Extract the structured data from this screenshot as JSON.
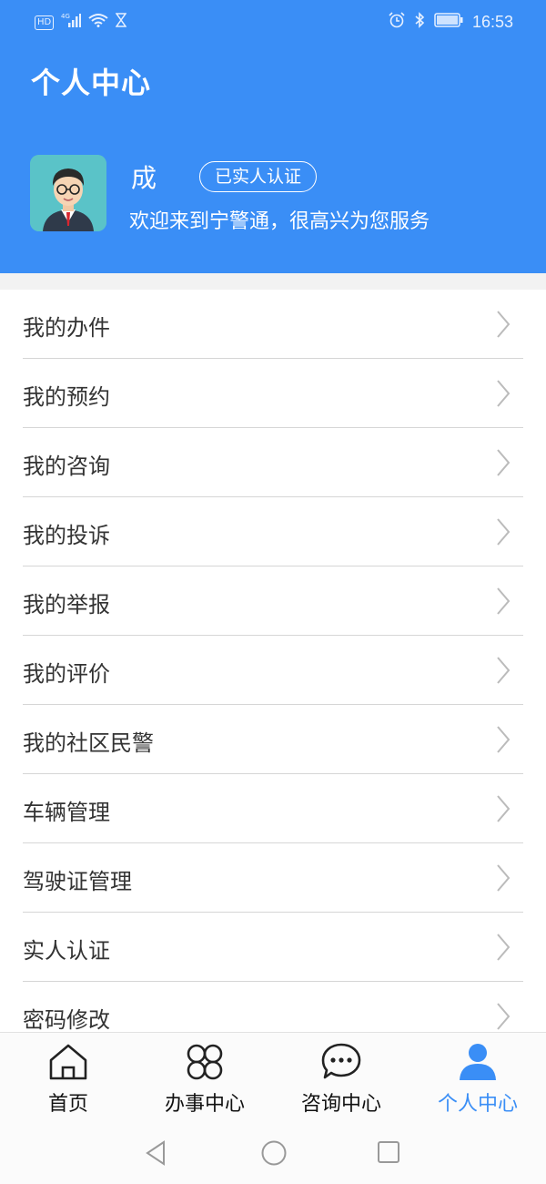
{
  "status_bar": {
    "network_badge": "HD",
    "signal": "4G",
    "time": "16:53",
    "icons": [
      "hd-icon",
      "signal-icon",
      "wifi-icon",
      "hourglass-icon",
      "alarm-icon",
      "bluetooth-icon",
      "battery-icon"
    ]
  },
  "header": {
    "title": "个人中心",
    "user_name": "成",
    "badge": "已实人认证",
    "welcome": "欢迎来到宁警通，很高兴为您服务",
    "accent_color": "#3a8ef6"
  },
  "menu": {
    "items": [
      {
        "label": "我的办件"
      },
      {
        "label": "我的预约"
      },
      {
        "label": "我的咨询"
      },
      {
        "label": "我的投诉"
      },
      {
        "label": "我的举报"
      },
      {
        "label": "我的评价"
      },
      {
        "label": "我的社区民警"
      },
      {
        "label": "车辆管理"
      },
      {
        "label": "驾驶证管理"
      },
      {
        "label": "实人认证"
      },
      {
        "label": "密码修改"
      }
    ]
  },
  "tabbar": {
    "tabs": [
      {
        "label": "首页",
        "icon": "home-icon"
      },
      {
        "label": "办事中心",
        "icon": "clover-icon"
      },
      {
        "label": "咨询中心",
        "icon": "chat-bubble-icon"
      },
      {
        "label": "个人中心",
        "icon": "person-icon",
        "active": true
      }
    ]
  },
  "navbar": {
    "buttons": [
      "back-icon",
      "home-circle-icon",
      "recent-apps-icon"
    ]
  }
}
